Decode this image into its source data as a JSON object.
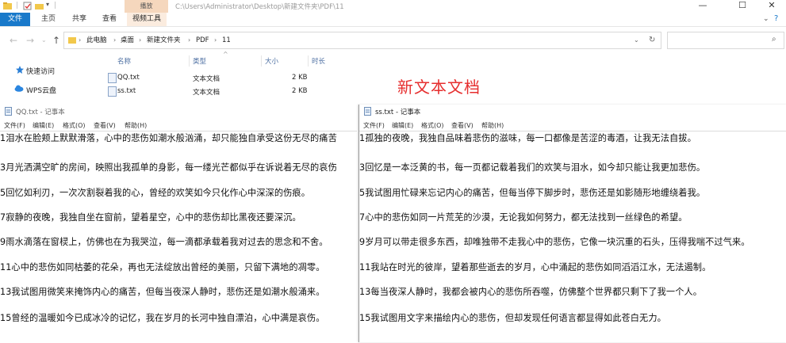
{
  "explorer": {
    "title_path": "C:\\Users\\Administrator\\Desktop\\新建文件夹\\PDF\\11",
    "context_tab": "播放",
    "ribbon_tabs": [
      "文件",
      "主页",
      "共享",
      "查看",
      "视频工具"
    ],
    "breadcrumb": [
      "此电脑",
      "桌面",
      "新建文件夹",
      "PDF",
      "11"
    ],
    "nav_items": [
      "快速访问",
      "WPS云盘"
    ],
    "columns": {
      "name": "名称",
      "type": "类型",
      "size": "大小",
      "length": "时长"
    },
    "files": [
      {
        "name": "QQ.txt",
        "type": "文本文档",
        "size": "2 KB"
      },
      {
        "name": "ss.txt",
        "type": "文本文档",
        "size": "2 KB"
      }
    ],
    "overlay_text": "新文本文档"
  },
  "notepad_left": {
    "title": "QQ.txt - 记事本",
    "menu": [
      "文件(F)",
      "编辑(E)",
      "格式(O)",
      "查看(V)",
      "帮助(H)"
    ],
    "lines": [
      "1泪水在脸颊上默默滑落，心中的悲伤如潮水般汹涌，却只能独自承受这份无尽的痛苦",
      "3月光洒满空旷的房间，映照出我孤单的身影，每一缕光芒都似乎在诉说着无尽的哀伤",
      "5回忆如利刃，一次次割裂着我的心，曾经的欢笑如今只化作心中深深的伤痕。",
      "7寂静的夜晚，我独自坐在窗前，望着星空，心中的悲伤却比黑夜还要深沉。",
      "9雨水滴落在窗棂上，仿佛也在为我哭泣，每一滴都承载着我对过去的思念和不舍。",
      "11心中的悲伤如同枯萎的花朵，再也无法绽放出曾经的美丽，只留下满地的凋零。",
      "13我试图用微笑来掩饰内心的痛苦，但每当夜深人静时，悲伤还是如潮水般涌来。",
      "15曾经的温暖如今已成冰冷的记忆，我在岁月的长河中独自漂泊，心中满是哀伤。"
    ]
  },
  "notepad_right": {
    "title": "ss.txt - 记事本",
    "menu": [
      "文件(F)",
      "编辑(E)",
      "格式(O)",
      "查看(V)",
      "帮助(H)"
    ],
    "lines": [
      "1孤独的夜晚，我独自品味着悲伤的滋味，每一口都像是苦涩的毒酒，让我无法自拔。",
      "3回忆是一本泛黄的书，每一页都记载着我们的欢笑与泪水，如今却只能让我更加悲伤。",
      "5我试图用忙碌来忘记内心的痛苦，但每当停下脚步时，悲伤还是如影随形地缠绕着我。",
      "7心中的悲伤如同一片荒芜的沙漠，无论我如何努力，都无法找到一丝绿色的希望。",
      "9岁月可以带走很多东西，却唯独带不走我心中的悲伤，它像一块沉重的石头，压得我喘不过气来。",
      "11我站在时光的彼岸，望着那些逝去的岁月，心中涌起的悲伤如同滔滔江水，无法遏制。",
      "13每当夜深人静时，我都会被内心的悲伤所吞噬，仿佛整个世界都只剩下了我一个人。",
      "15我试图用文字来描绘内心的悲伤，但却发现任何语言都显得如此苍白无力。"
    ]
  },
  "colors": {
    "accent": "#1979ca",
    "overlay": "#e62e2e",
    "context_tab": "#f5d7bd"
  }
}
